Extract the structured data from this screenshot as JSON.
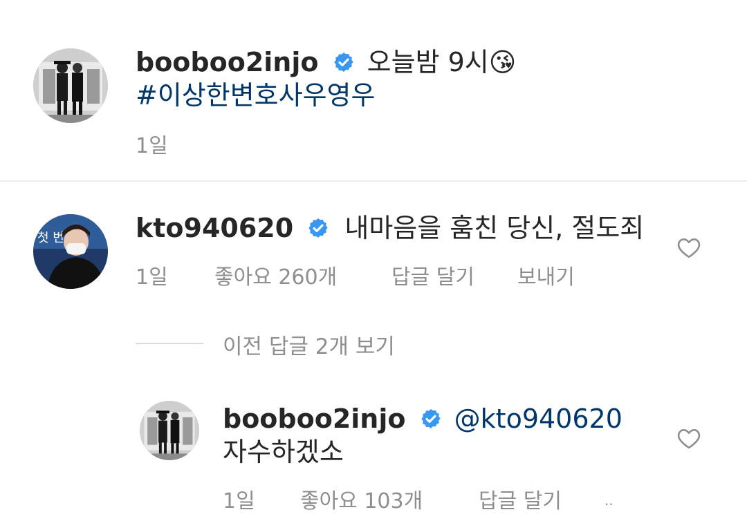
{
  "post": {
    "username": "booboo2injo",
    "caption": "오늘밤 9시",
    "emoji": "😘",
    "hashtag": "#이상한변호사우영우",
    "time": "1일"
  },
  "comment": {
    "username": "kto940620",
    "text": "내마음을 훔친 당신, 절도죄",
    "time": "1일",
    "likes": "좋아요 260개",
    "reply_label": "답글 달기",
    "send_label": "보내기"
  },
  "view_previous_replies": "이전 답글 2개 보기",
  "reply": {
    "username": "booboo2injo",
    "mention": "@kto940620",
    "text": "자수하겠소",
    "time": "1일",
    "likes": "좋아요 103개",
    "reply_label": "답글 달기",
    "more": ".."
  },
  "colors": {
    "verified": "#3897f0",
    "link": "#00376b",
    "secondary": "#8e8e8e"
  },
  "icons": {
    "verified": "verified-badge-icon",
    "heart": "heart-outline-icon"
  }
}
